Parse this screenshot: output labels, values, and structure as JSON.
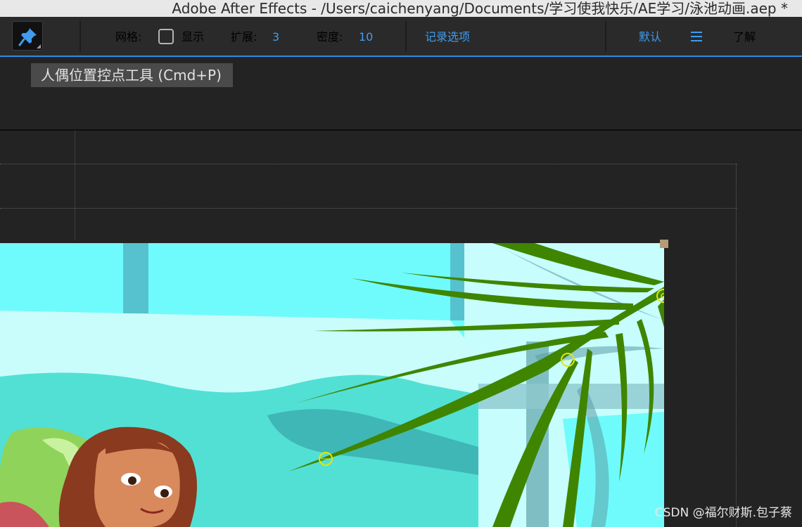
{
  "window": {
    "title": "Adobe After Effects - /Users/caichenyang/Documents/学习使我快乐/AE学习/泳池动画.aep *"
  },
  "toolbar": {
    "tool_icon": "pushpin-icon",
    "grid_label": "网格:",
    "grid_checked": false,
    "grid_show_label": "显示",
    "expand_label": "扩展:",
    "expand_value": "3",
    "density_label": "密度:",
    "density_value": "10",
    "record_options": "记录选项",
    "workspace_default": "默认",
    "workspace_menu_icon": "hamburger-menu-icon",
    "learn_label": "了解"
  },
  "tooltip": {
    "text": "人偶位置控点工具 (Cmd+P)"
  },
  "watermark": {
    "text": "CSDN @福尔财斯.包子蔡"
  },
  "colors": {
    "accent": "#3f9cf0",
    "pin_handle": "#e6e600",
    "leaf": "#3f8500",
    "pool": "#52e0d4",
    "sky": "#6ffbfb"
  },
  "puppet_pins": [
    {
      "name": "pin-1"
    },
    {
      "name": "pin-2"
    },
    {
      "name": "pin-3"
    }
  ]
}
